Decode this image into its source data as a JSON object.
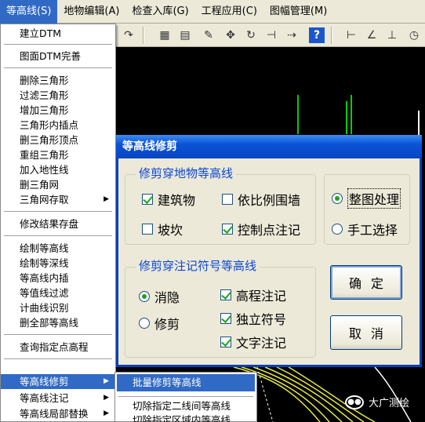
{
  "menubar": {
    "items": [
      "等高线(S)",
      "地物编辑(A)",
      "检查入库(G)",
      "工程应用(C)",
      "图幅管理(M)"
    ]
  },
  "toolbar": {
    "icons": [
      "redo-icon",
      "layer-color-icon",
      "grid-icon",
      "pencil-icon",
      "move-icon",
      "rotate-node-icon",
      "line-cross-icon",
      "dashed-line-icon",
      "help-icon",
      "h-measure-icon",
      "angle-icon",
      "dimension-icon",
      "clock-icon"
    ]
  },
  "dropdown": {
    "items": [
      {
        "label": "建立DTM"
      },
      {
        "label": "图面DTM完善"
      },
      {
        "label": "删除三角形"
      },
      {
        "label": "过滤三角形"
      },
      {
        "label": "增加三角形"
      },
      {
        "label": "三角形内插点"
      },
      {
        "label": "删三角形顶点"
      },
      {
        "label": "重组三角形"
      },
      {
        "label": "加入地性线"
      },
      {
        "label": "删三角网"
      },
      {
        "label": "三角网存取"
      },
      {
        "label": "修改结果存盘"
      },
      {
        "label": "绘制等高线"
      },
      {
        "label": "绘制等深线"
      },
      {
        "label": "等高线内插"
      },
      {
        "label": "等值线过滤"
      },
      {
        "label": "计曲线识别"
      },
      {
        "label": "删全部等高线"
      },
      {
        "label": "查询指定点高程"
      },
      {
        "label": "等高线修剪"
      },
      {
        "label": "等高线注记"
      },
      {
        "label": "等高线局部替换"
      }
    ]
  },
  "submenu": {
    "items": [
      {
        "label": "批量修剪等高线"
      },
      {
        "label": "切除指定二线间等高线"
      },
      {
        "label": "切除指定区域内等高线"
      }
    ]
  },
  "dialog": {
    "title": "等高线修剪",
    "group1": {
      "title": "修剪穿地物等高线",
      "options": [
        {
          "label": "建筑物",
          "checked": true
        },
        {
          "label": "依比例围墙",
          "checked": false
        },
        {
          "label": "坡坎",
          "checked": false
        },
        {
          "label": "控制点注记",
          "checked": true
        }
      ]
    },
    "group2": {
      "title": "修剪穿注记符号等高线",
      "radios": [
        {
          "label": "消隐",
          "selected": true
        },
        {
          "label": "修剪",
          "selected": false
        }
      ],
      "options": [
        {
          "label": "高程注记",
          "checked": true
        },
        {
          "label": "独立符号",
          "checked": true
        },
        {
          "label": "文字注记",
          "checked": true
        }
      ]
    },
    "mode": {
      "radios": [
        {
          "label": "整图处理",
          "selected": true
        },
        {
          "label": "手工选择",
          "selected": false
        }
      ]
    },
    "ok_label": "确定",
    "cancel_label": "取消"
  },
  "watermark": {
    "text": "大广测绘"
  },
  "colors": {
    "highlight": "#316ac5",
    "title_blue": "#0a52d6",
    "check_green": "#21a121",
    "group_title": "#0b46d4"
  }
}
